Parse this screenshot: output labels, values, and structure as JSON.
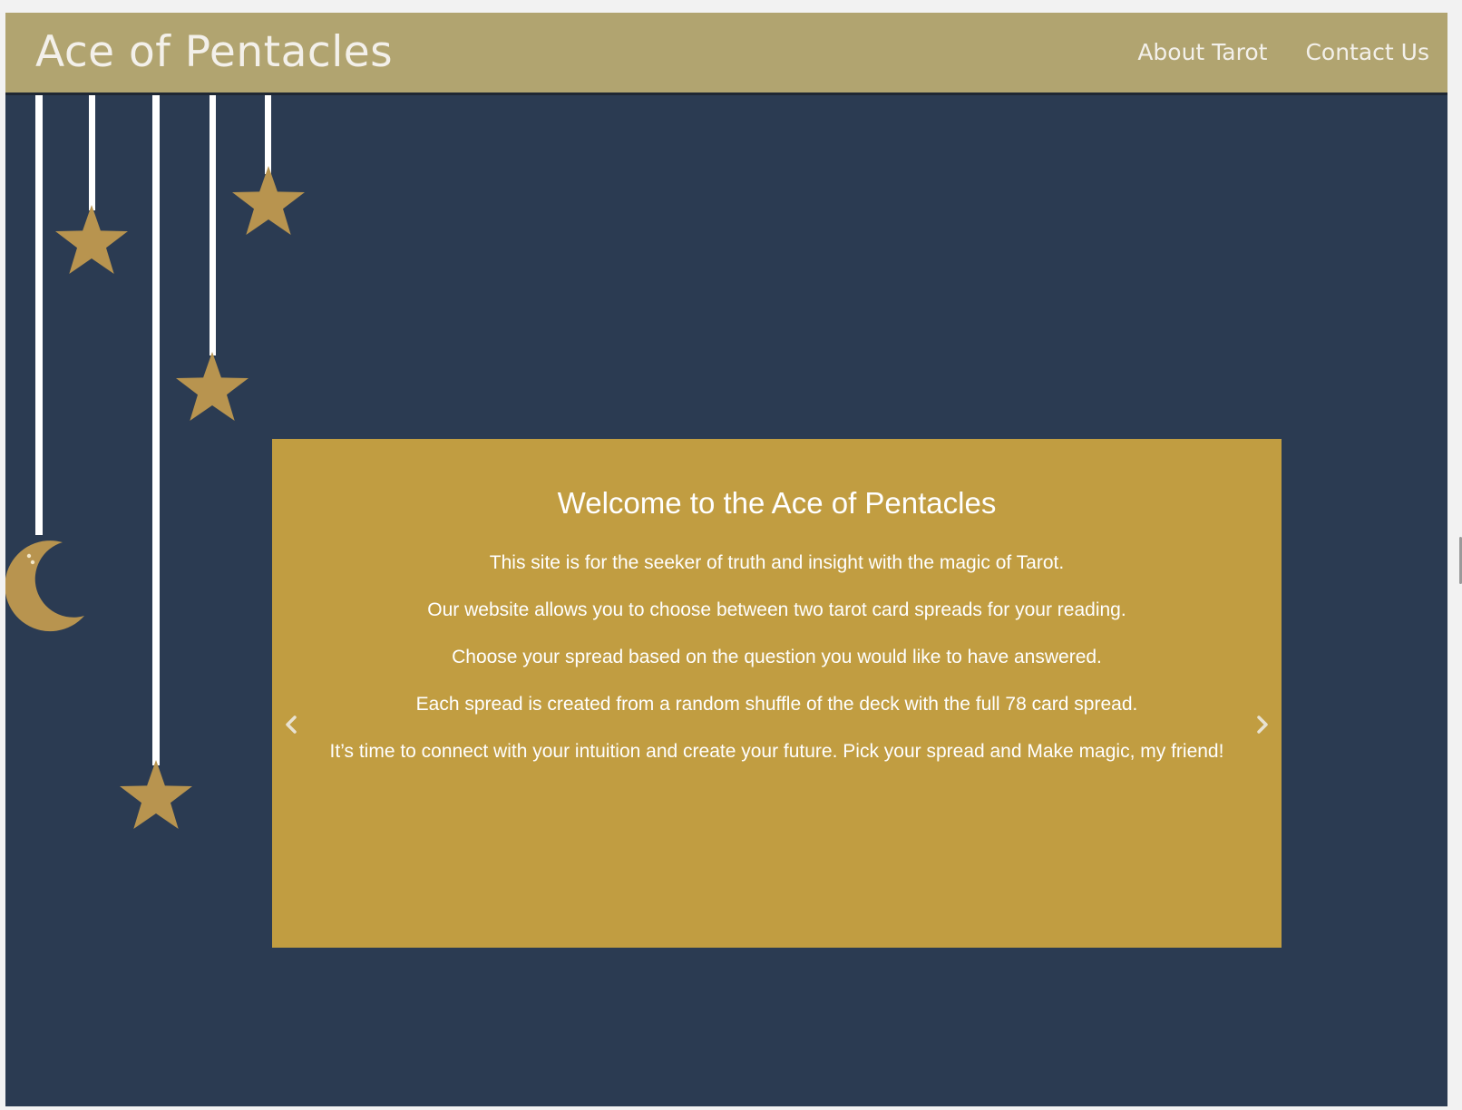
{
  "header": {
    "brand": "Ace of Pentacles",
    "nav": [
      {
        "label": "About Tarot"
      },
      {
        "label": "Contact Us"
      }
    ]
  },
  "carousel": {
    "title": "Welcome to the Ace of Pentacles",
    "paragraphs": [
      "This site is for the seeker of truth and insight with the magic of Tarot.",
      "Our website allows you to choose between two tarot card spreads for your reading.",
      "Choose your spread based on the question you would like to have answered.",
      "Each spread is created from a random shuffle of the deck with the full 78 card spread.",
      "It’s time to connect with your intuition and create your future. Pick your spread and Make magic, my friend!"
    ],
    "prev_icon": "chevron-left-icon",
    "next_icon": "chevron-right-icon"
  },
  "decorations": {
    "icons": [
      "star-icon",
      "moon-icon"
    ]
  },
  "colors": {
    "navbar": "#b1a470",
    "background": "#2b3b52",
    "panel": "#c19d41",
    "star": "#b8944f",
    "text": "#ffffff"
  }
}
